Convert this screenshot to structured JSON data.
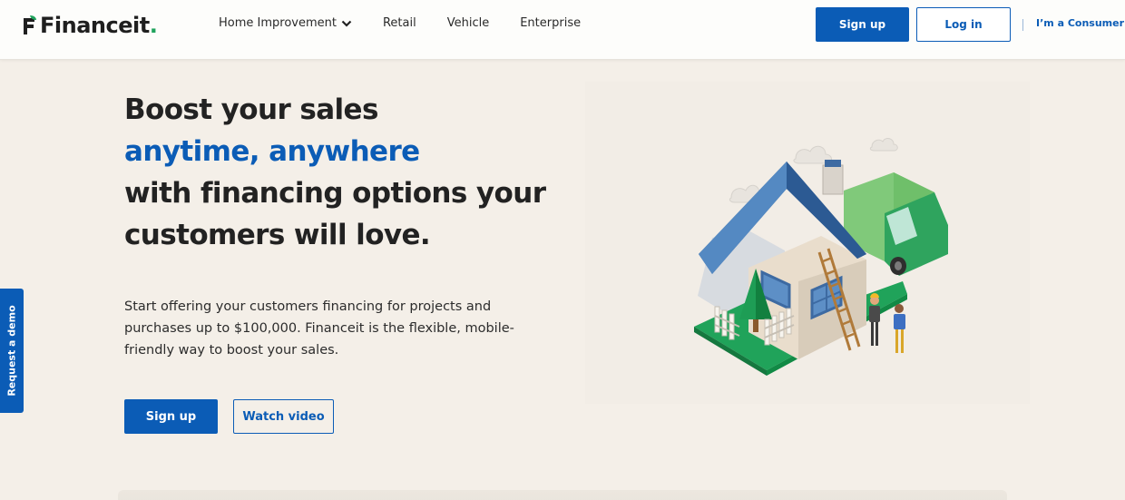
{
  "header": {
    "logo_text": "Financeit",
    "logo_dot": ".",
    "nav": [
      {
        "label": "Home Improvement",
        "has_dropdown": true
      },
      {
        "label": "Retail"
      },
      {
        "label": "Vehicle"
      },
      {
        "label": "Enterprise"
      }
    ],
    "signup_label": "Sign up",
    "login_label": "Log in",
    "consumer_label": "I’m a Consumer"
  },
  "hero": {
    "headline_line1": "Boost your sales",
    "headline_accent": "anytime, anywhere",
    "headline_line3": "with financing options your",
    "headline_line4": "customers will love.",
    "lead": "Start offering your customers financing for projects and purchases up to $100,000. Financeit is the flexible, mobile-friendly way to boost your sales.",
    "signup_label": "Sign up",
    "watch_label": "Watch video"
  },
  "side_tab": {
    "label": "Request a demo"
  },
  "colors": {
    "brand_blue": "#0b5cb6",
    "brand_green": "#1fa35c",
    "page_bg": "#f4efe8"
  },
  "icons": {
    "logo": "financeit-logo-icon",
    "dropdown": "chevron-down-icon",
    "illustration": "house-truck-illustration"
  }
}
